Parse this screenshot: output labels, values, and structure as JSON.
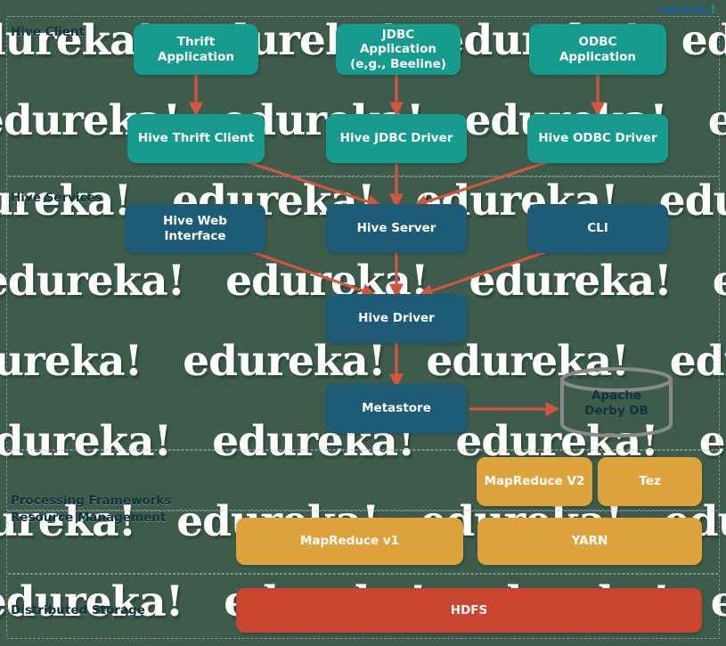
{
  "logo": {
    "text": "edureka",
    "bang": "!"
  },
  "colors": {
    "background": "#3d5c4b",
    "teal": "#169b8e",
    "navy": "#1d5b77",
    "orange": "#dfa33d",
    "red": "#c9452f",
    "arrow": "#d1553f",
    "db_outline": "#8a8a8a",
    "label": "#12323f",
    "watermark": "#ffffff"
  },
  "watermark": {
    "text": "edureka!"
  },
  "sections": [
    {
      "id": "hive-client",
      "label": "Hive Client"
    },
    {
      "id": "hive-services",
      "label": "Hive Services"
    },
    {
      "id": "processing-frameworks",
      "label": "Processing Frameworks"
    },
    {
      "id": "resource-management",
      "label": "Resource Management"
    },
    {
      "id": "distributed-storage",
      "label": "Distributed Storage"
    }
  ],
  "nodes": {
    "thrift_application": "Thrift Application",
    "jdbc_application_l1": "JDBC Application",
    "jdbc_application_l2": "(e,g., Beeline)",
    "odbc_application_l1": "ODBC",
    "odbc_application_l2": "Application",
    "hive_thrift_client": "Hive Thrift Client",
    "hive_jdbc_driver": "Hive JDBC Driver",
    "hive_odbc_driver": "Hive ODBC Driver",
    "hive_web_interface_l1": "Hive Web",
    "hive_web_interface_l2": "Interface",
    "hive_server": "Hive Server",
    "cli": "CLI",
    "hive_driver": "Hive Driver",
    "metastore": "Metastore",
    "apache_derby_l1": "Apache",
    "apache_derby_l2": "Derby DB",
    "mapreduce_v2": "MapReduce V2",
    "tez": "Tez",
    "mapreduce_v1": "MapReduce v1",
    "yarn": "YARN",
    "hdfs": "HDFS"
  },
  "connections": [
    {
      "from": "thrift_application",
      "to": "hive_thrift_client"
    },
    {
      "from": "jdbc_application",
      "to": "hive_jdbc_driver"
    },
    {
      "from": "odbc_application",
      "to": "hive_odbc_driver"
    },
    {
      "from": "hive_thrift_client",
      "to": "hive_server"
    },
    {
      "from": "hive_jdbc_driver",
      "to": "hive_server"
    },
    {
      "from": "hive_odbc_driver",
      "to": "hive_server"
    },
    {
      "from": "hive_web_interface",
      "to": "hive_driver"
    },
    {
      "from": "hive_server",
      "to": "hive_driver"
    },
    {
      "from": "cli",
      "to": "hive_driver"
    },
    {
      "from": "hive_driver",
      "to": "metastore"
    },
    {
      "from": "metastore",
      "to": "apache_derby_db"
    }
  ]
}
